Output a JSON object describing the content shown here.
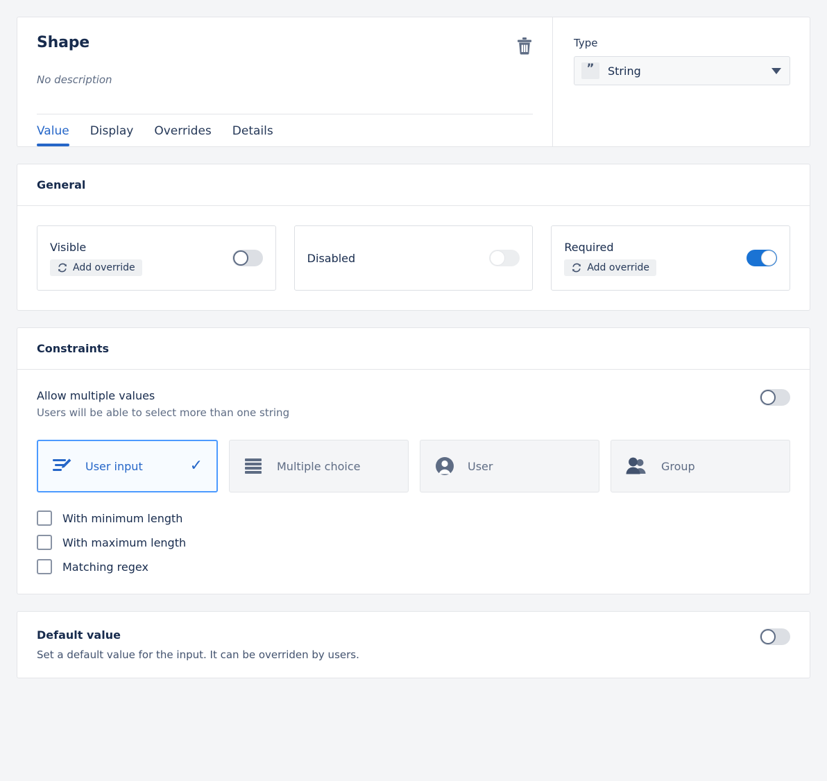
{
  "header": {
    "title": "Shape",
    "description": "No description",
    "delete_icon": "trash-icon",
    "tabs": [
      {
        "label": "Value",
        "active": true
      },
      {
        "label": "Display",
        "active": false
      },
      {
        "label": "Overrides",
        "active": false
      },
      {
        "label": "Details",
        "active": false
      }
    ],
    "type": {
      "label": "Type",
      "value": "String",
      "badge_glyph": "”",
      "badge_icon": "quote-icon",
      "caret_icon": "chevron-down-icon"
    }
  },
  "general": {
    "heading": "General",
    "items": [
      {
        "label": "Visible",
        "override_label": "Add override",
        "has_override": true,
        "toggle": "off"
      },
      {
        "label": "Disabled",
        "override_label": "",
        "has_override": false,
        "toggle": "off-muted"
      },
      {
        "label": "Required",
        "override_label": "Add override",
        "has_override": true,
        "toggle": "on"
      }
    ]
  },
  "constraints": {
    "heading": "Constraints",
    "allow_multiple": {
      "title": "Allow multiple values",
      "subtitle": "Users will be able to select more than one string",
      "toggle": "off"
    },
    "tiles": [
      {
        "label": "User input",
        "icon": "edit-lines-icon",
        "selected": true,
        "check_glyph": "✓"
      },
      {
        "label": "Multiple choice",
        "icon": "list-lines-icon",
        "selected": false,
        "check_glyph": ""
      },
      {
        "label": "User",
        "icon": "user-icon",
        "selected": false,
        "check_glyph": ""
      },
      {
        "label": "Group",
        "icon": "group-icon",
        "selected": false,
        "check_glyph": ""
      }
    ],
    "checkboxes": [
      {
        "label": "With minimum length",
        "checked": false
      },
      {
        "label": "With maximum length",
        "checked": false
      },
      {
        "label": "Matching regex",
        "checked": false
      }
    ]
  },
  "default_value": {
    "title": "Default value",
    "subtitle": "Set a default value for the input. It can be overriden by users.",
    "toggle": "off"
  },
  "colors": {
    "accent": "#2566c8",
    "toggle_on": "#1a73d4",
    "page_bg": "#f4f5f7",
    "card_bg": "#ffffff",
    "border": "#e3e5e8",
    "text": "#172b4d",
    "muted_text": "#5e6c84"
  }
}
